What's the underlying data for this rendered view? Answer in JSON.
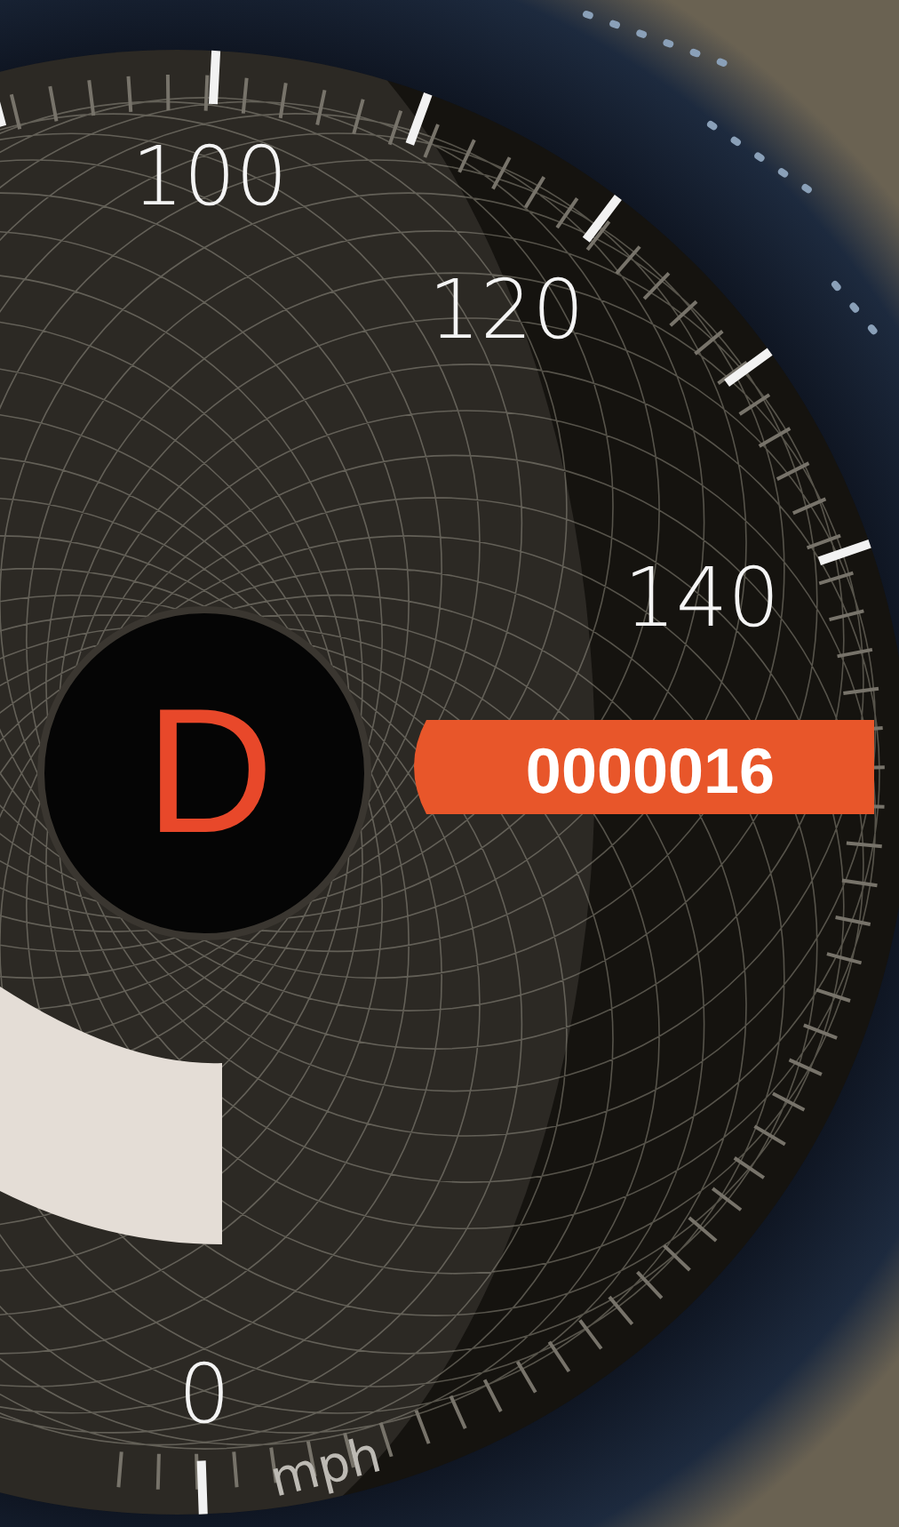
{
  "speedometer": {
    "scale_labels": [
      "100",
      "120",
      "140",
      "0"
    ],
    "unit": "mph",
    "gear": "D",
    "odometer": "0000016"
  }
}
